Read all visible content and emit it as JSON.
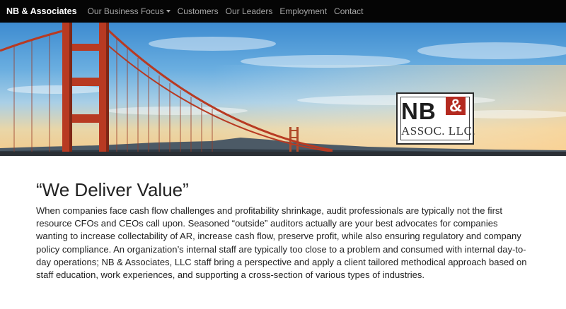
{
  "navbar": {
    "brand": "NB & Associates",
    "items": [
      {
        "label": "Our Business Focus",
        "dropdown": true
      },
      {
        "label": "Customers"
      },
      {
        "label": "Our Leaders"
      },
      {
        "label": "Employment"
      },
      {
        "label": "Contact"
      }
    ]
  },
  "hero": {
    "logo": {
      "line1": "NB",
      "ampersand": "&",
      "line2": "ASSOC. LLC."
    }
  },
  "main": {
    "headline": "“We Deliver Value”",
    "body": "When companies face cash flow challenges and profitability shrinkage, audit professionals are typically not the first resource CFOs and CEOs call upon. Seasoned “outside” auditors actually are your best advocates for companies wanting to increase collectability of AR, increase cash flow, preserve profit, while also ensuring regulatory and company policy compliance. An organization’s internal staff are typically too close to a problem and consumed with internal day-to-day operations; NB & Associates, LLC staff bring a perspective and apply a client tailored methodical approach based on staff education, work experiences, and supporting a cross-section of various types of industries."
  },
  "colors": {
    "navbar_bg": "#050505",
    "brand_text": "#ffffff",
    "nav_link": "#a6a6a6",
    "bridge": "#b83a22",
    "logo_accent": "#b42a20"
  }
}
